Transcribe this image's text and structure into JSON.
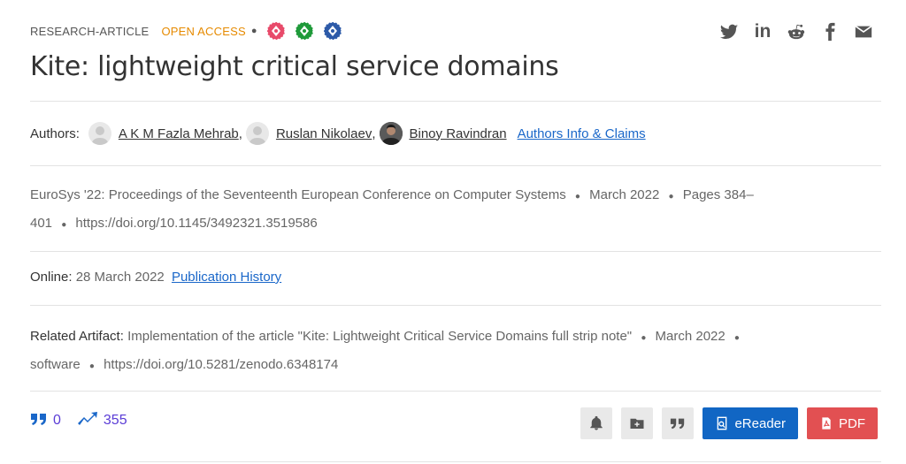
{
  "header": {
    "type_label": "RESEARCH-ARTICLE",
    "open_access_label": "OPEN ACCESS",
    "badge_colors": [
      "#e84a6a",
      "#1f9a3a",
      "#2d5aa8"
    ]
  },
  "share": {
    "items": [
      "twitter-icon",
      "linkedin-icon",
      "reddit-icon",
      "facebook-icon",
      "email-icon"
    ],
    "linkedin_text": "in"
  },
  "title": "Kite: lightweight critical service domains",
  "authors": {
    "label": "Authors:",
    "list": [
      {
        "name": "A K M Fazla Mehrab",
        "suffix": ","
      },
      {
        "name": "Ruslan Nikolaev",
        "suffix": ","
      },
      {
        "name": "Binoy Ravindran",
        "suffix": ""
      }
    ],
    "info_link": "Authors Info & Claims"
  },
  "publication": {
    "venue": "EuroSys '22: Proceedings of the Seventeenth European Conference on Computer Systems",
    "date": "March 2022",
    "pages": "Pages 384–",
    "pages_cont": "401",
    "doi": "https://doi.org/10.1145/3492321.3519586",
    "separator": "●"
  },
  "online": {
    "label": "Online:",
    "date": "28 March 2022",
    "history_link": "Publication History"
  },
  "artifact": {
    "label": "Related Artifact:",
    "description": "Implementation of the article \"Kite: Lightweight Critical Service Domains full strip note\"",
    "date": "March 2022",
    "kind": "software",
    "doi": "https://doi.org/10.5281/zenodo.6348174"
  },
  "metrics": {
    "citations": "0",
    "downloads": "355"
  },
  "actions": {
    "ereader_label": "eReader",
    "pdf_label": "PDF",
    "ereader_color": "#1166c4",
    "pdf_color": "#e25052"
  }
}
